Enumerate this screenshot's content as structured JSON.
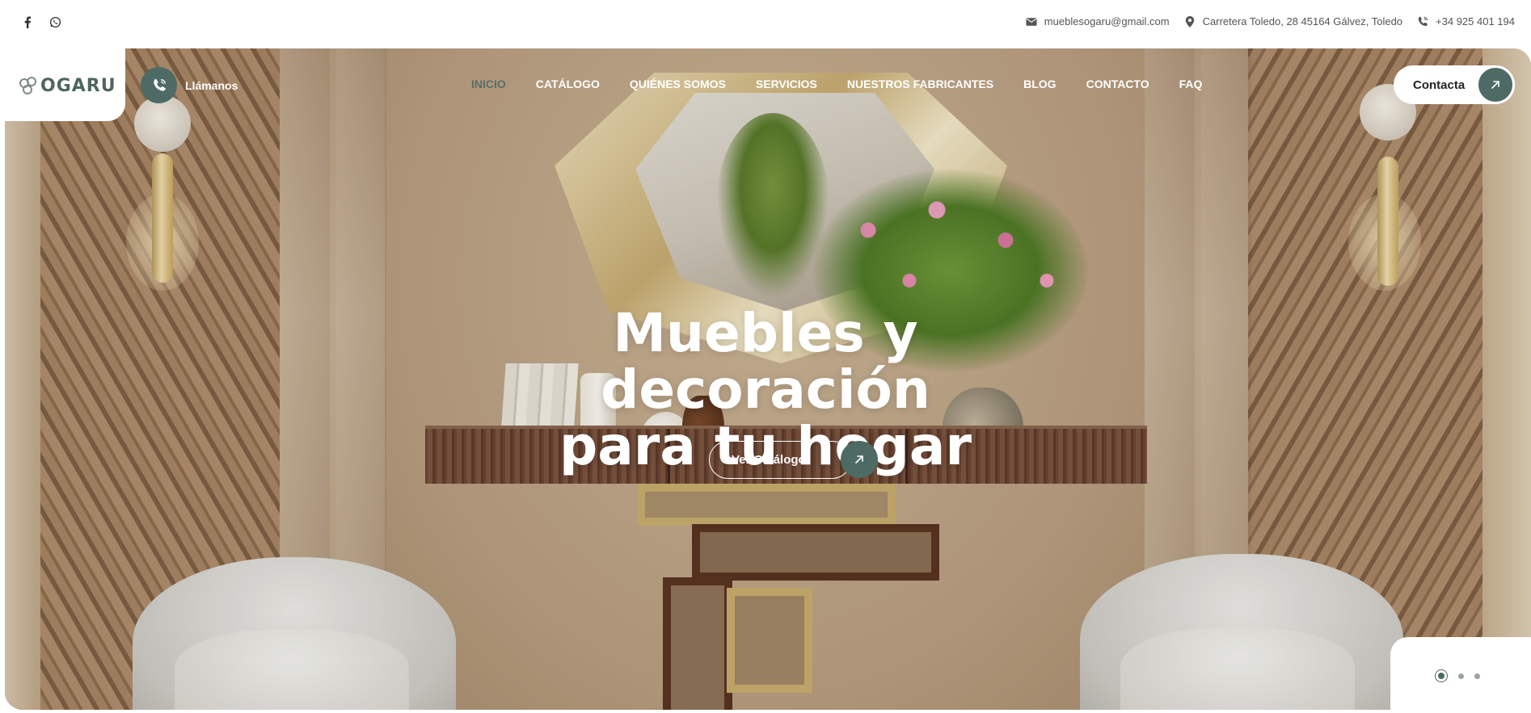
{
  "topbar": {
    "social": [
      "facebook-icon",
      "whatsapp-icon"
    ],
    "email": "mueblesogaru@gmail.com",
    "address": "Carretera Toledo, 28 45164 Gálvez, Toledo",
    "phone": "+34 925 401 194"
  },
  "brand": {
    "logo_text": "OGARU"
  },
  "call": {
    "label": "Llámanos"
  },
  "nav": {
    "items": [
      {
        "label": "INICIO",
        "active": true
      },
      {
        "label": "CATÁLOGO",
        "active": false
      },
      {
        "label": "QUIÉNES SOMOS",
        "active": false
      },
      {
        "label": "SERVICIOS",
        "active": false
      },
      {
        "label": "NUESTROS FABRICANTES",
        "active": false
      },
      {
        "label": "BLOG",
        "active": false
      },
      {
        "label": "CONTACTO",
        "active": false
      },
      {
        "label": "FAQ",
        "active": false
      }
    ]
  },
  "header_cta": {
    "label": "Contacta"
  },
  "hero": {
    "title_line1": "Muebles y decoración",
    "title_line2": "para tu hogar",
    "cta_label": "Ver Catálogo"
  },
  "slider": {
    "count": 3,
    "active_index": 0
  },
  "colors": {
    "accent": "#4d6b64",
    "active_nav": "#56706a"
  }
}
